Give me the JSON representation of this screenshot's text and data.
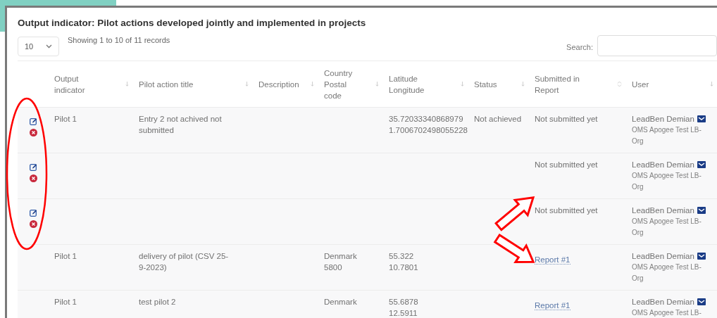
{
  "title": "Output indicator: Pilot actions developed jointly and implemented in projects",
  "page_size": {
    "value": "10"
  },
  "info": "Showing 1 to 10 of 11 records",
  "search": {
    "label": "Search:"
  },
  "table": {
    "columns": [
      {
        "label": "Output indicator",
        "sorted": false
      },
      {
        "label": "Pilot action title",
        "sorted": false
      },
      {
        "label": "Description",
        "sorted": false
      },
      {
        "label": "Country Postal code",
        "sorted": false
      },
      {
        "label": "Latitude Longitude",
        "sorted": false
      },
      {
        "label": "Status",
        "sorted": false
      },
      {
        "label": "Submitted in Report",
        "sorted": true
      },
      {
        "label": "User",
        "sorted": false
      }
    ],
    "rows": [
      {
        "editable": true,
        "output_indicator": "Pilot 1",
        "title": "Entry 2 not achived not submitted",
        "latitude": "35.72033340868979",
        "longitude": "1.7006702498055228",
        "status": "Not achieved",
        "report": {
          "kind": "text",
          "text": "Not submitted yet"
        },
        "user": "LeadBen Demian",
        "organisation": "OMS Apogee Test LB-Org"
      },
      {
        "editable": true,
        "report": {
          "kind": "text",
          "text": "Not submitted yet"
        },
        "user": "LeadBen Demian",
        "organisation": "OMS Apogee Test LB-Org"
      },
      {
        "editable": true,
        "report": {
          "kind": "text",
          "text": "Not submitted yet"
        },
        "user": "LeadBen Demian",
        "organisation": "OMS Apogee Test LB-Org"
      },
      {
        "editable": false,
        "output_indicator": "Pilot 1",
        "title": "delivery of pilot (CSV 25-9-2023)",
        "country": "Denmark",
        "postal_code": "5800",
        "latitude": "55.322",
        "longitude": "10.7801",
        "report": {
          "kind": "link",
          "text": "Report #1"
        },
        "user": "LeadBen Demian",
        "organisation": "OMS Apogee Test LB-Org"
      },
      {
        "editable": false,
        "output_indicator": "Pilot 1",
        "title": "test pilot 2",
        "country": "Denmark",
        "latitude": "55.6878",
        "longitude": "12.5911",
        "report": {
          "kind": "link",
          "text": "Report #1"
        },
        "user": "LeadBen Demian",
        "organisation": "OMS Apogee Test LB-"
      }
    ]
  }
}
